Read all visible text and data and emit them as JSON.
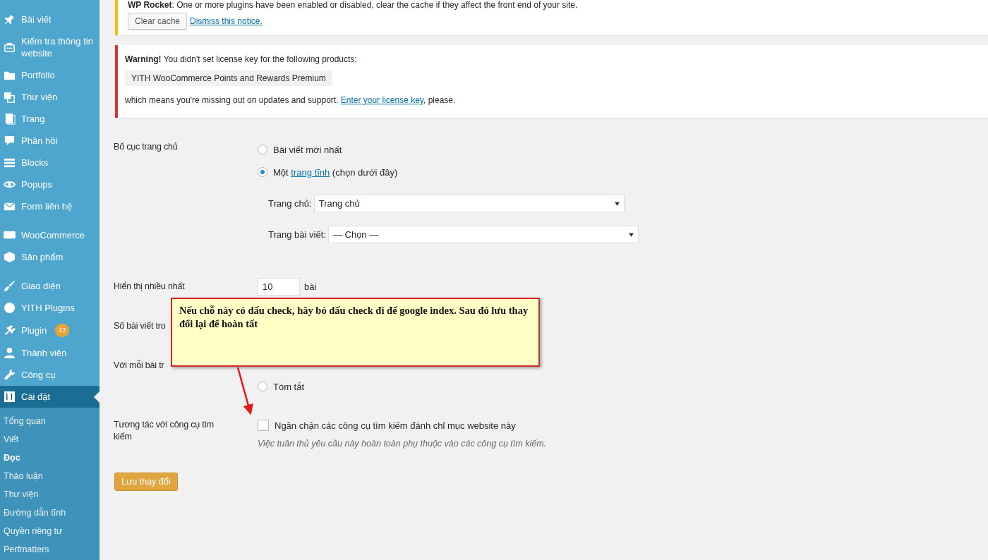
{
  "sidebar": {
    "items": [
      {
        "kind": "item",
        "label": "Bài viết",
        "selected": false
      },
      {
        "kind": "item",
        "label": "Kiểm tra thông tin website",
        "selected": false
      },
      {
        "kind": "item",
        "label": "Portfolio",
        "selected": false
      },
      {
        "kind": "item",
        "label": "Thư viện",
        "selected": false
      },
      {
        "kind": "item",
        "label": "Trang",
        "selected": false
      },
      {
        "kind": "item",
        "label": "Phản hồi",
        "selected": false
      },
      {
        "kind": "item",
        "label": "Blocks",
        "selected": false
      },
      {
        "kind": "item",
        "label": "Popups",
        "selected": false
      },
      {
        "kind": "item",
        "label": "Form liên hệ",
        "selected": false
      },
      {
        "kind": "separator"
      },
      {
        "kind": "item",
        "label": "WooCommerce",
        "selected": false
      },
      {
        "kind": "item",
        "label": "Sản phẩm",
        "selected": false
      },
      {
        "kind": "separator"
      },
      {
        "kind": "item",
        "label": "Giao diện",
        "selected": false
      },
      {
        "kind": "item",
        "label": "YITH Plugins",
        "selected": false
      },
      {
        "kind": "item",
        "label": "Plugin",
        "badge": "13",
        "selected": false
      },
      {
        "kind": "item",
        "label": "Thành viên",
        "selected": false
      },
      {
        "kind": "item",
        "label": "Công cụ",
        "selected": false
      },
      {
        "kind": "item",
        "label": "Cài đặt",
        "selected": true
      }
    ],
    "submenu": [
      {
        "label": "Tổng quan",
        "selected": false
      },
      {
        "label": "Viết",
        "selected": false
      },
      {
        "label": "Đọc",
        "selected": true
      },
      {
        "label": "Thảo luận",
        "selected": false
      },
      {
        "label": "Thư viện",
        "selected": false
      },
      {
        "label": "Đường dẫn tĩnh",
        "selected": false
      },
      {
        "label": "Quyền riêng tư",
        "selected": false
      },
      {
        "label": "Perfmatters",
        "selected": false
      }
    ]
  },
  "notices": [
    {
      "kind": "warning",
      "text": "**WP Rocket**: One or more plugins have been enabled or disabled, clear the cache if they affect the front end of your site.",
      "button": "Clear cache",
      "link": "Dismiss this notice."
    },
    {
      "kind": "error",
      "text": "**Warning!** You didn't set license key for the following products:",
      "product": "YITH WooCommerce Points and Rewards Premium",
      "footer_before": "which means you're missing out on updates and support.",
      "footer_link": "Enter your license key",
      "footer_after": ", please."
    }
  ],
  "front_page": {
    "label": "Bố cục trang chủ",
    "options": [
      {
        "text": "Bài viết mới nhất",
        "selected": false
      },
      {
        "text": "Một",
        "link": "trang tĩnh",
        "text_after": "(chọn dưới đây)",
        "selected": true
      }
    ],
    "selects": [
      {
        "label": "Trang chủ:",
        "value": "Trang chủ"
      },
      {
        "label": "Trang bài viết:",
        "value": "— Chọn —"
      }
    ]
  },
  "posts_per_page": {
    "label": "Hiển thị nhiều nhất",
    "value": "10",
    "unit": "bài"
  },
  "feed_count": {
    "label": "Số bài viết tro"
  },
  "feed_content": {
    "label": "Với mỗi bài tr",
    "options": [
      {
        "text": "Tóm tắt",
        "selected": false
      }
    ]
  },
  "search_visibility": {
    "label": "Tương tác với công cụ tìm kiếm",
    "checkbox": {
      "label": "Ngăn chặn các công cụ tìm kiếm đánh chỉ mục website này",
      "checked": false
    },
    "description": "Việc tuân thủ yêu cầu này hoàn toàn phụ thuộc vào các công cụ tìm kiếm."
  },
  "save_button": "Lưu thay đổi",
  "callout": {
    "text": "Nếu chỗ này có dấu check, hãy bỏ dấu check đi để google index. Sau đó lưu thay đổi lại để hoàn tất"
  }
}
